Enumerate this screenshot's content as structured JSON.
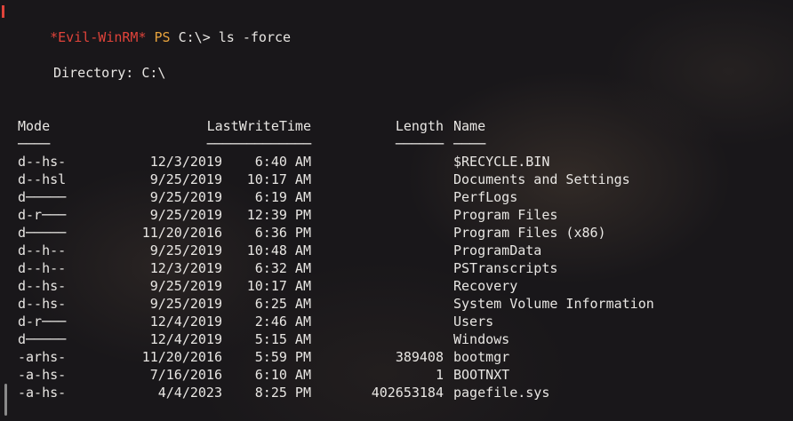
{
  "prompt": {
    "name": "*Evil-WinRM*",
    "ps": "PS",
    "path": "C:\\>",
    "command": "ls -force"
  },
  "directory_line": "Directory: C:\\",
  "headers": {
    "mode": "Mode",
    "lastwrite": "LastWriteTime",
    "length": "Length",
    "name": "Name",
    "mode_ul": "────",
    "lastwrite_ul": "─────────────",
    "length_ul": "──────",
    "name_ul": "────"
  },
  "rows": [
    {
      "mode": "d--hs-",
      "date": "12/3/2019",
      "time": "6:40 AM",
      "length": "",
      "name": "$RECYCLE.BIN"
    },
    {
      "mode": "d--hsl",
      "date": "9/25/2019",
      "time": "10:17 AM",
      "length": "",
      "name": "Documents and Settings"
    },
    {
      "mode": "d─────",
      "date": "9/25/2019",
      "time": "6:19 AM",
      "length": "",
      "name": "PerfLogs"
    },
    {
      "mode": "d-r───",
      "date": "9/25/2019",
      "time": "12:39 PM",
      "length": "",
      "name": "Program Files"
    },
    {
      "mode": "d─────",
      "date": "11/20/2016",
      "time": "6:36 PM",
      "length": "",
      "name": "Program Files (x86)"
    },
    {
      "mode": "d--h--",
      "date": "9/25/2019",
      "time": "10:48 AM",
      "length": "",
      "name": "ProgramData"
    },
    {
      "mode": "d--h--",
      "date": "12/3/2019",
      "time": "6:32 AM",
      "length": "",
      "name": "PSTranscripts"
    },
    {
      "mode": "d--hs-",
      "date": "9/25/2019",
      "time": "10:17 AM",
      "length": "",
      "name": "Recovery"
    },
    {
      "mode": "d--hs-",
      "date": "9/25/2019",
      "time": "6:25 AM",
      "length": "",
      "name": "System Volume Information"
    },
    {
      "mode": "d-r───",
      "date": "12/4/2019",
      "time": "2:46 AM",
      "length": "",
      "name": "Users"
    },
    {
      "mode": "d─────",
      "date": "12/4/2019",
      "time": "5:15 AM",
      "length": "",
      "name": "Windows"
    },
    {
      "mode": "-arhs-",
      "date": "11/20/2016",
      "time": "5:59 PM",
      "length": "389408",
      "name": "bootmgr"
    },
    {
      "mode": "-a-hs-",
      "date": "7/16/2016",
      "time": "6:10 AM",
      "length": "1",
      "name": "BOOTNXT"
    },
    {
      "mode": "-a-hs-",
      "date": "4/4/2023",
      "time": "8:25 PM",
      "length": "402653184",
      "name": "pagefile.sys"
    }
  ]
}
